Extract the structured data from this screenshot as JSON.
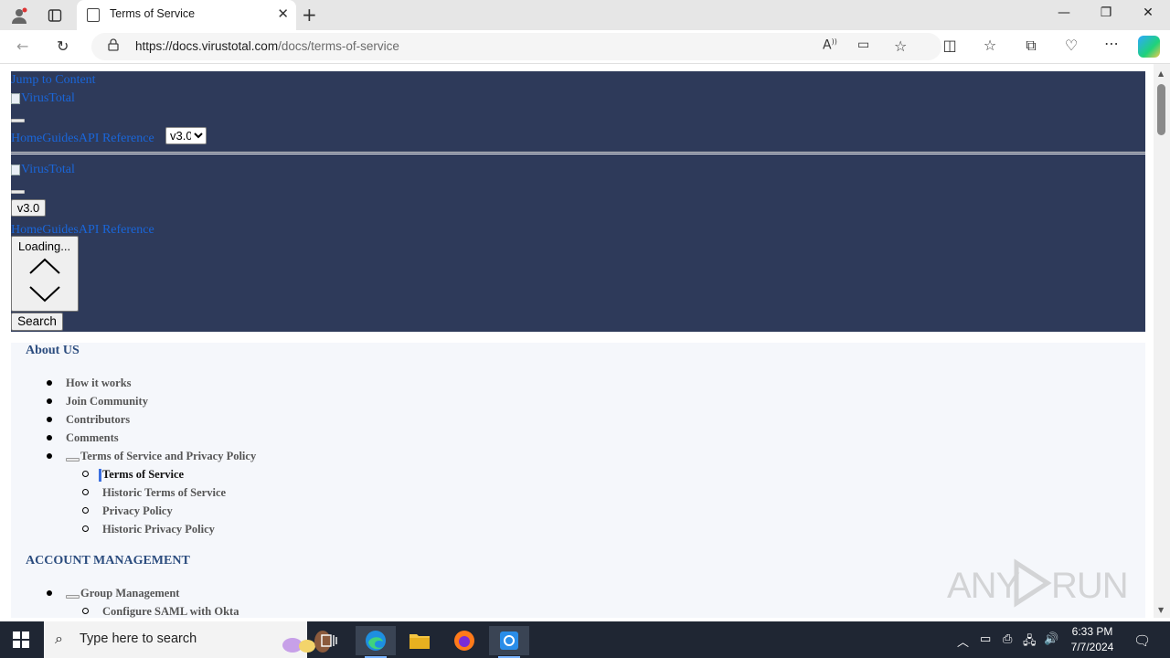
{
  "browser": {
    "tab_title": "Terms of Service",
    "url_host": "https://docs.virustotal.com",
    "url_path": "/docs/terms-of-service"
  },
  "page": {
    "skip_link": "Jump to Content",
    "logo_alt": "VirusTotal",
    "nav": [
      "Home",
      "Guides",
      "API Reference"
    ],
    "version": "v3.0",
    "loading": "Loading...",
    "search_label": "Search"
  },
  "sidebar": {
    "sections": [
      {
        "title": "About US",
        "items": [
          "How it works",
          "Join Community",
          "Contributors",
          "Comments"
        ],
        "group": {
          "label": "Terms of Service and Privacy Policy",
          "children": [
            "Terms of Service",
            "Historic Terms of Service",
            "Privacy Policy",
            "Historic Privacy Policy"
          ],
          "active": "Terms of Service"
        }
      },
      {
        "title": "ACCOUNT MANAGEMENT",
        "group": {
          "label": "Group Management",
          "children": [
            "Configure SAML with Okta"
          ]
        }
      }
    ]
  },
  "watermark": "ANY RUN",
  "taskbar": {
    "search_placeholder": "Type here to search",
    "time": "6:33 PM",
    "date": "7/7/2024"
  },
  "colors": {
    "header_bg": "#2e3a5a",
    "link": "#1a66d9",
    "section_title": "#2b4c7e",
    "sidebar_bg": "#f5f7fb",
    "active_marker": "#3b6fe0"
  }
}
